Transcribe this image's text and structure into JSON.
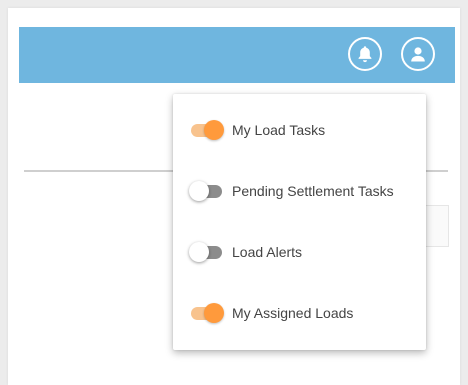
{
  "header": {
    "notification_icon": "bell-icon",
    "profile_icon": "user-icon",
    "bar_color": "#6fb6df"
  },
  "dropdown": {
    "items": [
      {
        "label": "My Load Tasks",
        "enabled": true
      },
      {
        "label": "Pending Settlement Tasks",
        "enabled": false
      },
      {
        "label": "Load Alerts",
        "enabled": false
      },
      {
        "label": "My Assigned Loads",
        "enabled": true
      }
    ]
  },
  "colors": {
    "toggle_on_knob": "#ff9a3c",
    "toggle_on_track": "#f8c38e",
    "toggle_off_track": "#8c8c8c"
  }
}
